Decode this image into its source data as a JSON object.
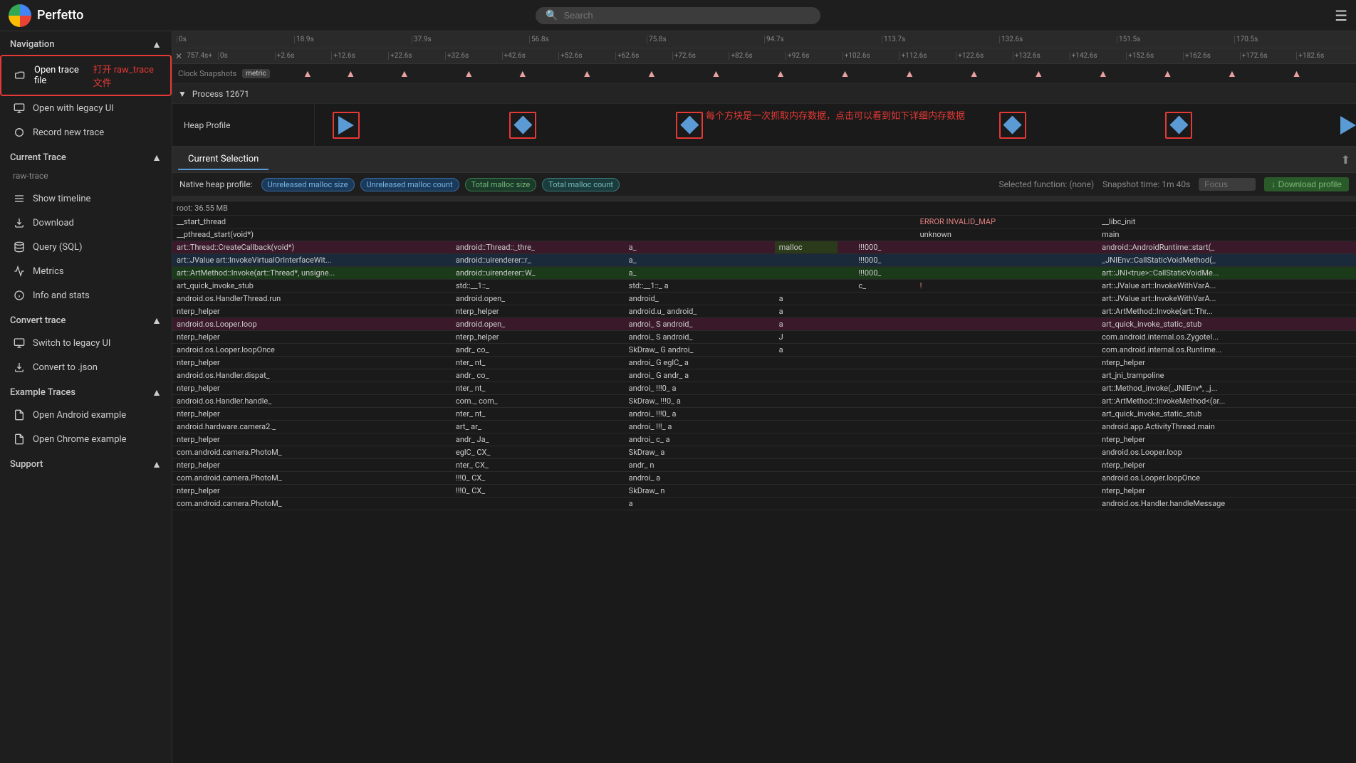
{
  "app": {
    "title": "Perfetto",
    "search_placeholder": "Search"
  },
  "sidebar": {
    "navigation_label": "Navigation",
    "items_nav": [
      {
        "id": "open-trace",
        "label": "Open trace file",
        "icon": "folder"
      },
      {
        "id": "open-legacy",
        "label": "Open with legacy UI",
        "icon": "monitor"
      },
      {
        "id": "record-new",
        "label": "Record new trace",
        "icon": "circle"
      }
    ],
    "annotation_text": "打开 raw_trace 文件",
    "current_trace_label": "Current Trace",
    "trace_name": "raw-trace",
    "items_trace": [
      {
        "id": "show-timeline",
        "label": "Show timeline",
        "icon": "timeline"
      },
      {
        "id": "download",
        "label": "Download",
        "icon": "download"
      },
      {
        "id": "query-sql",
        "label": "Query (SQL)",
        "icon": "database"
      },
      {
        "id": "metrics",
        "label": "Metrics",
        "icon": "chart"
      },
      {
        "id": "info-stats",
        "label": "Info and stats",
        "icon": "info"
      }
    ],
    "convert_trace_label": "Convert trace",
    "items_convert": [
      {
        "id": "switch-legacy",
        "label": "Switch to legacy UI",
        "icon": "monitor"
      },
      {
        "id": "convert-json",
        "label": "Convert to .json",
        "icon": "download"
      }
    ],
    "example_traces_label": "Example Traces",
    "items_examples": [
      {
        "id": "open-android",
        "label": "Open Android example",
        "icon": "file"
      },
      {
        "id": "open-chrome",
        "label": "Open Chrome example",
        "icon": "file"
      }
    ],
    "support_label": "Support"
  },
  "timeline": {
    "ruler_top_ticks": [
      "0s",
      "18.9s",
      "37.9s",
      "56.8s",
      "75.8s",
      "94.7s",
      "113.7s",
      "132.6s",
      "151.5s",
      "170.5s"
    ],
    "ruler_secondary_start": "757.4s+",
    "ruler_secondary_ticks": [
      "0s",
      "+2.6s",
      "+12.6s",
      "+22.6s",
      "+32.6s",
      "+42.6s",
      "+52.6s",
      "+62.6s",
      "+72.6s",
      "+82.6s",
      "+92.6s",
      "+102.6s",
      "+112.6s",
      "+122.6s",
      "+132.6s",
      "+142.6s",
      "+152.6s",
      "+162.6s",
      "+172.6s",
      "+182.6s"
    ],
    "clock_label": "Clock Snapshots",
    "metric_badge": "metric",
    "annotation": "每个方块是一次抓取内存数据，点击可以看到如下详细内存数据",
    "process_label": "Process 12671",
    "heap_profile_label": "Heap Profile"
  },
  "selection_panel": {
    "tab_label": "Current Selection",
    "profile_label": "Native heap profile:",
    "badges": [
      {
        "label": "Unreleased malloc size",
        "style": "blue"
      },
      {
        "label": "Unreleased malloc count",
        "style": "blue"
      },
      {
        "label": "Total malloc size",
        "style": "green"
      },
      {
        "label": "Total malloc count",
        "style": "teal"
      }
    ],
    "selected_function": "Selected function: (none)",
    "snapshot_time": "Snapshot time: 1m 40s",
    "focus_placeholder": "Focus",
    "download_profile_label": "↓ Download profile",
    "root_size": "root: 36.55 MB",
    "columns": [
      "",
      "",
      "",
      "",
      "",
      "",
      "",
      "",
      ""
    ],
    "rows": [
      {
        "c1": "__start_thread",
        "c2": "",
        "c3": "",
        "c4": "",
        "c5": "",
        "c6": "",
        "c7": "ERROR INVALID_MAP",
        "c8": "",
        "c9": "__libc_init",
        "style": ""
      },
      {
        "c1": "__pthread_start(void*)",
        "c2": "",
        "c3": "",
        "c4": "",
        "c5": "",
        "c6": "",
        "c7": "unknown",
        "c8": "",
        "c9": "main",
        "style": ""
      },
      {
        "c1": "art::Thread::CreateCallback(void*)",
        "c2": "android::Thread::_thre_",
        "c3": "a_",
        "c4": "malloc",
        "c5": "",
        "c6": "!!!000_",
        "c7": "",
        "c8": "",
        "c9": "android::AndroidRuntime::start(_",
        "style": "pink"
      },
      {
        "c1": "art::JValue art::InvokeVirtualOrInterfaceWit...",
        "c2": "android::uirenderer::r_",
        "c3": "a_",
        "c4": "",
        "c5": "",
        "c6": "!!!000_",
        "c7": "",
        "c8": "",
        "c9": "_JNIEnv::CallStaticVoidMethod(_",
        "style": "lightblue"
      },
      {
        "c1": "art::ArtMethod::Invoke(art::Thread*, unsigne...",
        "c2": "android::uirenderer::W_",
        "c3": "a_",
        "c4": "",
        "c5": "",
        "c6": "!!!000_",
        "c7": "",
        "c8": "",
        "c9": "art::JNI<true>::CallStaticVoidMe...",
        "style": "lightgreen"
      },
      {
        "c1": "art_quick_invoke_stub",
        "c2": "std::__1::_",
        "c3": "std::__1::_ a",
        "c4": "",
        "c5": "",
        "c6": "c_",
        "c7": "!",
        "c8": "",
        "c9": "art::JValue art::InvokeWithVarA...",
        "style": ""
      },
      {
        "c1": "android.os.HandlerThread.run",
        "c2": "android.open_",
        "c3": "android_",
        "c4": "a",
        "c5": "",
        "c6": "",
        "c7": "",
        "c8": "",
        "c9": "art::JValue art::InvokeWithVarA...",
        "style": ""
      },
      {
        "c1": "nterp_helper",
        "c2": "nterp_helper",
        "c3": "android.u_ android_",
        "c4": "a",
        "c5": "",
        "c6": "",
        "c7": "",
        "c8": "",
        "c9": "art::ArtMethod::Invoke(art::Thr...",
        "style": ""
      },
      {
        "c1": "android.os.Looper.loop",
        "c2": "android.open_",
        "c3": "androi_ S android_",
        "c4": "a",
        "c5": "",
        "c6": "",
        "c7": "",
        "c8": "",
        "c9": "art_quick_invoke_static_stub",
        "style": "pink"
      },
      {
        "c1": "nterp_helper",
        "c2": "nterp_helper",
        "c3": "androi_ S android_",
        "c4": "J",
        "c5": "",
        "c6": "",
        "c7": "",
        "c8": "",
        "c9": "com.android.internal.os.ZygoteI...",
        "style": ""
      },
      {
        "c1": "android.os.Looper.loopOnce",
        "c2": "andr_ co_",
        "c3": "SkDraw_ G androi_",
        "c4": "a",
        "c5": "",
        "c6": "",
        "c7": "",
        "c8": "",
        "c9": "com.android.internal.os.Runtime...",
        "style": ""
      },
      {
        "c1": "nterp_helper",
        "c2": "nter_ nt_",
        "c3": "androi_ G eglC_ a",
        "c4": "",
        "c5": "",
        "c6": "",
        "c7": "",
        "c8": "",
        "c9": "nterp_helper",
        "style": ""
      },
      {
        "c1": "android.os.Handler.dispat_",
        "c2": "andr_ co_",
        "c3": "androi_ G andr_ a",
        "c4": "",
        "c5": "",
        "c6": "",
        "c7": "",
        "c8": "",
        "c9": "art_jni_trampoline",
        "style": ""
      },
      {
        "c1": "nterp_helper",
        "c2": "nter_ nt_",
        "c3": "androi_ !!!0_ a",
        "c4": "",
        "c5": "",
        "c6": "",
        "c7": "",
        "c8": "",
        "c9": "art::Method_invoke(_JNIEnv*, _j...",
        "style": ""
      },
      {
        "c1": "android.os.Handler.handle_",
        "c2": "com._ com_",
        "c3": "SkDraw_ !!!0_ a",
        "c4": "",
        "c5": "",
        "c6": "",
        "c7": "",
        "c8": "",
        "c9": "art::ArtMethod::InvokeMethod<(ar...",
        "style": ""
      },
      {
        "c1": "nterp_helper",
        "c2": "nter_ nt_",
        "c3": "androi_ !!!0_ a",
        "c4": "",
        "c5": "",
        "c6": "",
        "c7": "",
        "c8": "",
        "c9": "art_quick_invoke_static_stub",
        "style": ""
      },
      {
        "c1": "android.hardware.camera2._",
        "c2": "art_ ar_",
        "c3": "androi_ !!!_ a",
        "c4": "",
        "c5": "",
        "c6": "",
        "c7": "",
        "c8": "",
        "c9": "android.app.ActivityThread.main",
        "style": ""
      },
      {
        "c1": "nterp_helper",
        "c2": "andr_ Ja_",
        "c3": "androi_ c_ a",
        "c4": "",
        "c5": "",
        "c6": "",
        "c7": "",
        "c8": "",
        "c9": "nterp_helper",
        "style": ""
      },
      {
        "c1": "com.android.camera.PhotoM_",
        "c2": "eglC_ CX_",
        "c3": "SkDraw_ a",
        "c4": "",
        "c5": "",
        "c6": "",
        "c7": "",
        "c8": "",
        "c9": "android.os.Looper.loop",
        "style": ""
      },
      {
        "c1": "nterp_helper",
        "c2": "nter_ CX_",
        "c3": "andr_ n",
        "c4": "",
        "c5": "",
        "c6": "",
        "c7": "",
        "c8": "",
        "c9": "nterp_helper",
        "style": ""
      },
      {
        "c1": "com.android.camera.PhotoM_",
        "c2": "!!!0_ CX_",
        "c3": "androi_ a",
        "c4": "",
        "c5": "",
        "c6": "",
        "c7": "",
        "c8": "",
        "c9": "android.os.Looper.loopOnce",
        "style": ""
      },
      {
        "c1": "nterp_helper",
        "c2": "!!!0_ CX_",
        "c3": "SkDraw_ n",
        "c4": "",
        "c5": "",
        "c6": "",
        "c7": "",
        "c8": "",
        "c9": "nterp_helper",
        "style": ""
      },
      {
        "c1": "com.android.camera.PhotoM_",
        "c2": "",
        "c3": "a",
        "c4": "",
        "c5": "",
        "c6": "",
        "c7": "",
        "c8": "",
        "c9": "android.os.Handler.handleMessage",
        "style": ""
      }
    ]
  }
}
